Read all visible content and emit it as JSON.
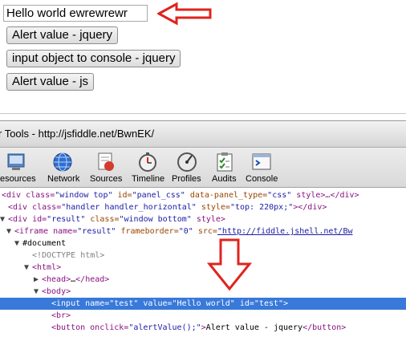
{
  "page": {
    "input_value": "Hello world ewrewrewr",
    "buttons": [
      "Alert value - jquery",
      "input object to console - jquery",
      "Alert value - js"
    ]
  },
  "devtools": {
    "title": "r Tools - http://jsfiddle.net/BwnEK/",
    "tools": [
      "esources",
      "Network",
      "Sources",
      "Timeline",
      "Profiles",
      "Audits",
      "Console"
    ],
    "dom_lines": {
      "l1_a": "<div class=",
      "l1_b": "\"window top\"",
      "l1_c": " id=",
      "l1_d": "\"panel_css\"",
      "l1_e": " data-panel_type=",
      "l1_f": "\"css\"",
      "l1_g": " style>…</div>",
      "l2_a": "<div class=",
      "l2_b": "\"handler handler_horizontal\"",
      "l2_c": " style=",
      "l2_d": "\"top: 220px;\"",
      "l2_e": "></div>",
      "l3_a": "<div id=",
      "l3_b": "\"result\"",
      "l3_c": " class=",
      "l3_d": "\"window bottom\"",
      "l3_e": " style>",
      "l4_a": "<iframe name=",
      "l4_b": "\"result\"",
      "l4_c": " frameborder=",
      "l4_d": "\"0\"",
      "l4_e": " src=",
      "l4_f": "\"http://fiddle.jshell.net/Bw",
      "l5": "#document",
      "l6": "<!DOCTYPE html>",
      "l7": "<html>",
      "l8_a": "<head>",
      "l8_b": "…",
      "l8_c": "</head>",
      "l9": "<body>",
      "l10_a": "<input name=",
      "l10_b": "\"test\"",
      "l10_c": " value=",
      "l10_d": "\"Hello world\"",
      "l10_e": " id=",
      "l10_f": "\"test\"",
      "l10_g": ">",
      "l11": "<br>",
      "l12_a": "<button onclick=",
      "l12_b": "\"alertValue();\"",
      "l12_c": ">",
      "l12_d": "Alert value - jquery",
      "l12_e": "</button>"
    }
  },
  "colors": {
    "arrow_red": "#e0231c",
    "selection_blue": "#3879d9"
  }
}
